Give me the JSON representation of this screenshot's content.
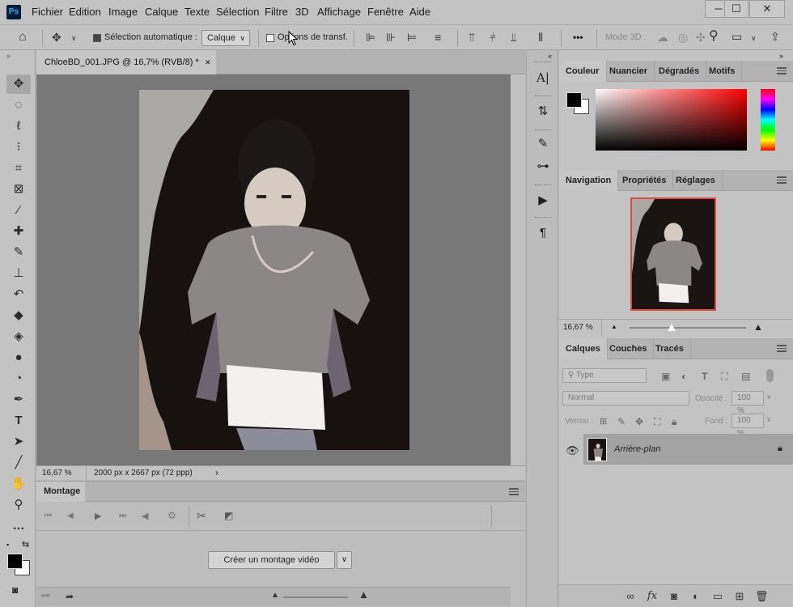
{
  "app": {
    "logo": "Ps"
  },
  "menu": [
    "Fichier",
    "Edition",
    "Image",
    "Calque",
    "Texte",
    "Sélection",
    "Filtre",
    "3D",
    "Affichage",
    "Fenêtre",
    "Aide"
  ],
  "window_controls": {
    "minimize": "─",
    "maximize": "☐",
    "close": "✕"
  },
  "options_bar": {
    "auto_select_label": "Sélection automatique :",
    "auto_select_target": "Calque",
    "transform_options_label": "Options de transf.",
    "mode_3d_label": "Mode 3D :",
    "more": "•••"
  },
  "document": {
    "tab_title": "ChloeBD_001.JPG @ 16,7% (RVB/8) *",
    "close_icon": "✕",
    "zoom": "16,67 %",
    "size_info": "2000 px x 2667 px (72 ppp)",
    "status_arrow": "›"
  },
  "timeline": {
    "tab_label": "Montage",
    "create_button": "Créer un montage vidéo",
    "dropdown": "∨"
  },
  "color_panel": {
    "tabs": [
      "Couleur",
      "Nuancier",
      "Dégradés",
      "Motifs"
    ],
    "foreground": "#000000",
    "background": "#ffffff"
  },
  "navigation_panel": {
    "tabs": [
      "Navigation",
      "Propriétés",
      "Réglages"
    ],
    "zoom": "16,67 %"
  },
  "layers_panel": {
    "tabs": [
      "Calques",
      "Couches",
      "Tracés"
    ],
    "filter_placeholder": "Type",
    "blend_mode": "Normal",
    "opacity_label": "Opacité :",
    "opacity_value": "100 %",
    "lock_label": "Verrou :",
    "fill_label": "Fond :",
    "fill_value": "100 %",
    "layers": [
      {
        "name": "Arrière-plan"
      }
    ]
  }
}
